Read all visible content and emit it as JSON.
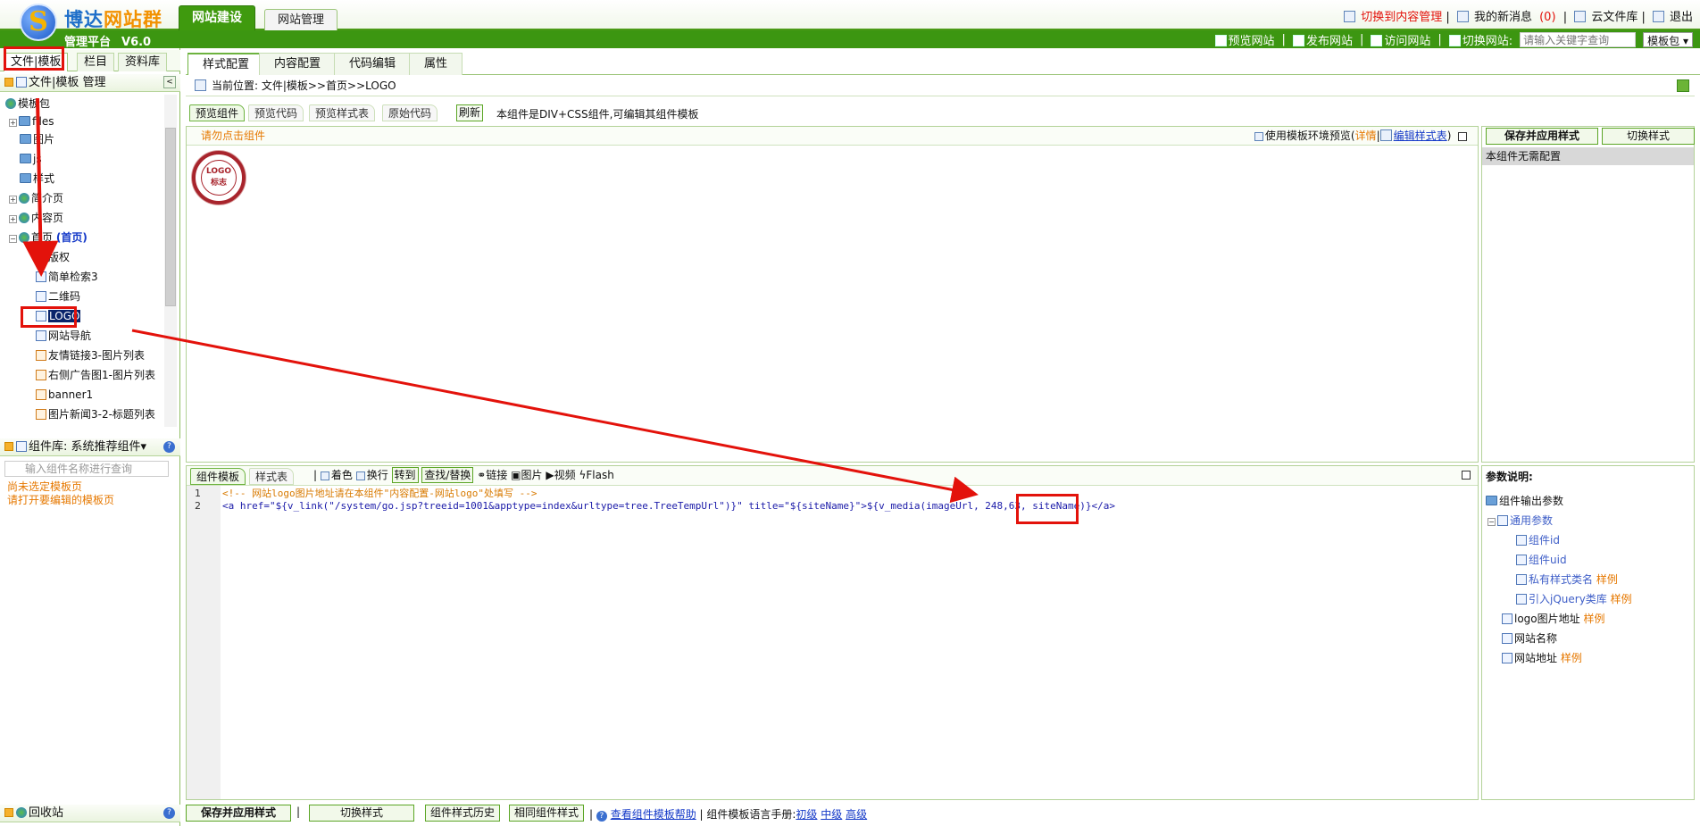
{
  "brand": {
    "name_part1": "博达",
    "name_part2": "网站群",
    "platform": "管理平台",
    "version": "V6.0",
    "logo_letter": "S"
  },
  "main_tabs": [
    "网站建设",
    "网站管理"
  ],
  "top_links": {
    "switch_content": "切换到内容管理",
    "messages": "我的新消息",
    "msg_count": "(0)",
    "cloud": "云文件库",
    "logout": "退出"
  },
  "green_links": {
    "preview": "预览网站",
    "publish": "发布网站",
    "visit": "访问网站",
    "switch": "切换网站:",
    "search_placeholder": "请输入关键字查询",
    "package": "模板包"
  },
  "left_tabs": [
    "文件|模板",
    "栏目",
    "资料库"
  ],
  "file_panel_title": "文件|模板 管理",
  "tree": {
    "root": "模板包",
    "items": [
      "files",
      "图片",
      "js",
      "样式",
      "简介页",
      "内容页",
      "首页"
    ],
    "home_tag": "(首页)",
    "children": [
      "版权",
      "简单检索3",
      "二维码",
      "LOGO",
      "网站导航",
      "友情链接3-图片列表",
      "右侧广告图1-图片列表",
      "banner1",
      "图片新闻3-2-标题列表"
    ]
  },
  "complib": {
    "title": "组件库: 系统推荐组件",
    "search_placeholder": "输入组件名称进行查询",
    "msg1": "尚未选定模板页",
    "msg2": "请打开要编辑的模板页"
  },
  "recycle": "回收站",
  "tabs": [
    "样式配置",
    "内容配置",
    "代码编辑",
    "属性"
  ],
  "breadcrumb": "当前位置: 文件|模板>>首页>>LOGO",
  "subtabs": [
    "预览组件",
    "预览代码",
    "预览样式表",
    "原始代码"
  ],
  "refresh": "刷新",
  "component_info": "本组件是DIV+CSS组件,可编辑其组件模板",
  "preview": {
    "hint": "请勿点击组件",
    "use_env": "使用模板环境预览",
    "detail": "详情",
    "edit_css": "编辑样式表",
    "logo_text": "LOGO",
    "logo_sub": "标志"
  },
  "right": {
    "save_apply": "保存并应用样式",
    "switch_style": "切换样式",
    "no_config": "本组件无需配置"
  },
  "editor": {
    "tabs": [
      "组件模板",
      "样式表"
    ],
    "tools": [
      "着色",
      "换行",
      "转到",
      "查找/替换",
      "链接",
      "图片",
      "视频",
      "Flash"
    ],
    "line1": "<!-- 网站logo图片地址请在本组件\"内容配置-网站logo\"处填写 -->",
    "line2_a": "<a href=\"${v_link(\"/system/go.jsp?treeid=1001&apptype=index&urltype=tree.TreeTempUrl\")}\" title=\"${siteName}\">${v_media(imageUrl,",
    "line2_b": " 248,63,",
    "line2_c": " siteName)}</a>"
  },
  "params": {
    "title": "参数说明:",
    "root": "组件输出参数",
    "common": "通用参数",
    "common_items": [
      "组件id",
      "组件uid",
      "私有样式类名",
      "引入jQuery类库"
    ],
    "others": [
      "logo图片地址",
      "网站名称",
      "网站地址"
    ],
    "sample": "样例"
  },
  "bottom": {
    "save_apply": "保存并应用样式",
    "switch_style": "切换样式",
    "history": "组件样式历史",
    "same": "相同组件样式",
    "help": "查看组件模板帮助",
    "manual": "组件模板语言手册:",
    "levels": [
      "初级",
      "中级",
      "高级"
    ]
  }
}
